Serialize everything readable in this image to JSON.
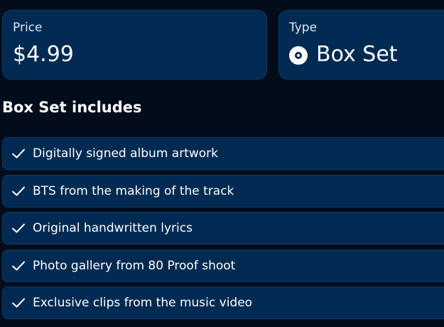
{
  "price": {
    "label": "Price",
    "value": "$4.99"
  },
  "type": {
    "label": "Type",
    "value": "Box Set",
    "icon": "disc-icon"
  },
  "section": {
    "title": "Box Set includes"
  },
  "includes": [
    "Digitally signed album artwork",
    "BTS from the making of the track",
    "Original handwritten lyrics",
    "Photo gallery from 80 Proof shoot",
    "Exclusive clips from the music video"
  ],
  "colors": {
    "background": "#020c1b",
    "card": "#012a52",
    "border": "#0b3b6a",
    "text": "#ffffff"
  }
}
